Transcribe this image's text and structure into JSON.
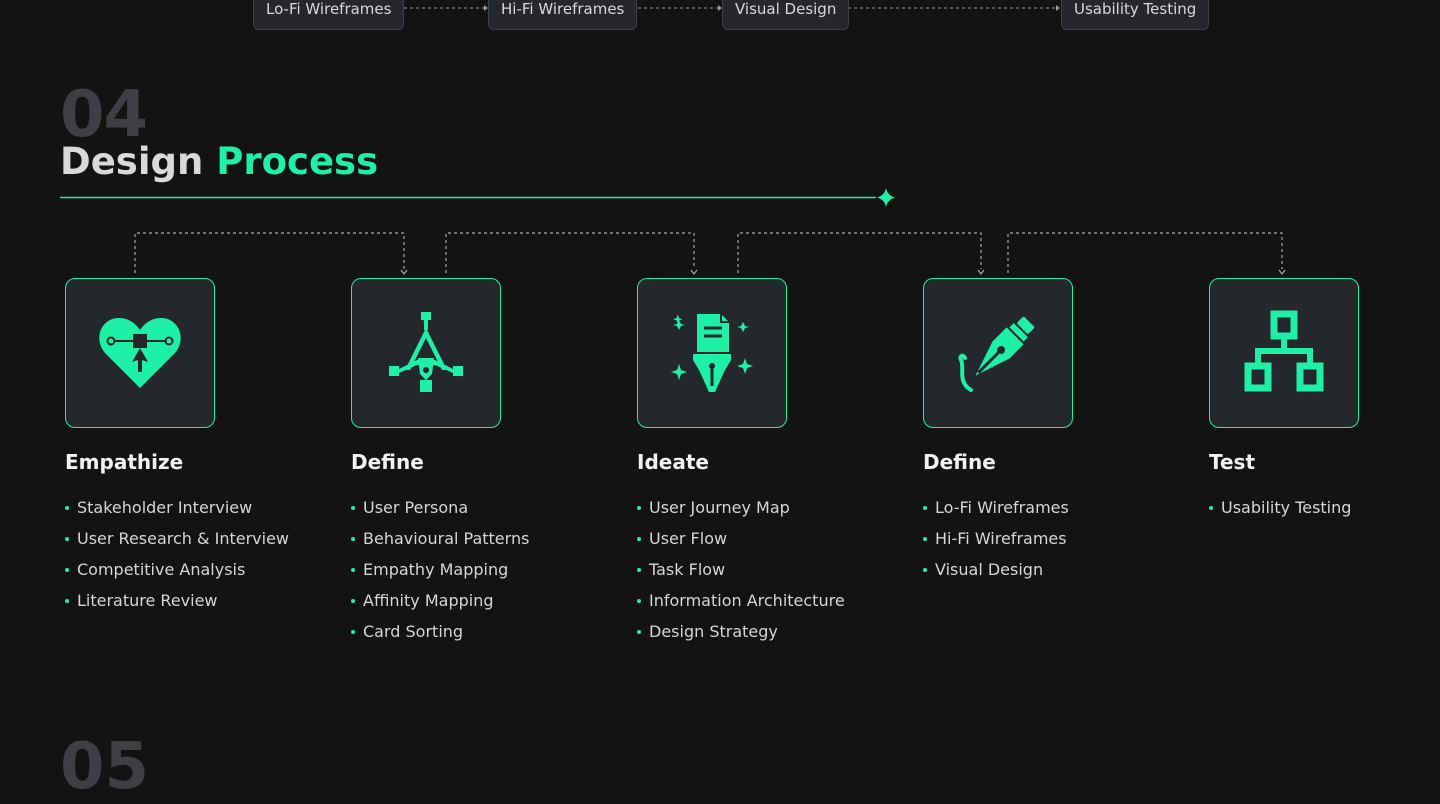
{
  "top_flow": {
    "chips": [
      "Lo-Fi Wireframes",
      "Hi-Fi Wireframes",
      "Visual Design",
      "Usability Testing"
    ]
  },
  "section": {
    "number": "04",
    "title_main": "Design",
    "title_accent": "Process"
  },
  "colors": {
    "accent": "#1ef0a8",
    "background": "#131313",
    "card": "#25282b"
  },
  "stages": [
    {
      "title": "Empathize",
      "icon": "heart-vector-icon",
      "items": [
        "Stakeholder Interview",
        "User Research & Interview",
        "Competitive Analysis",
        "Literature Review"
      ]
    },
    {
      "title": "Define",
      "icon": "pen-tool-compass-icon",
      "items": [
        "User Persona",
        "Behavioural Patterns",
        "Empathy Mapping",
        "Affinity Mapping",
        "Card Sorting"
      ]
    },
    {
      "title": "Ideate",
      "icon": "pen-nib-sparkle-icon",
      "items": [
        "User Journey Map",
        "User Flow",
        "Task Flow",
        "Information Architecture",
        "Design Strategy"
      ]
    },
    {
      "title": "Define",
      "icon": "fountain-pen-icon",
      "items": [
        "Lo-Fi Wireframes",
        "Hi-Fi Wireframes",
        "Visual Design"
      ]
    },
    {
      "title": "Test",
      "icon": "sitemap-icon",
      "items": [
        "Usability Testing"
      ]
    }
  ],
  "next_section": {
    "number": "05"
  }
}
